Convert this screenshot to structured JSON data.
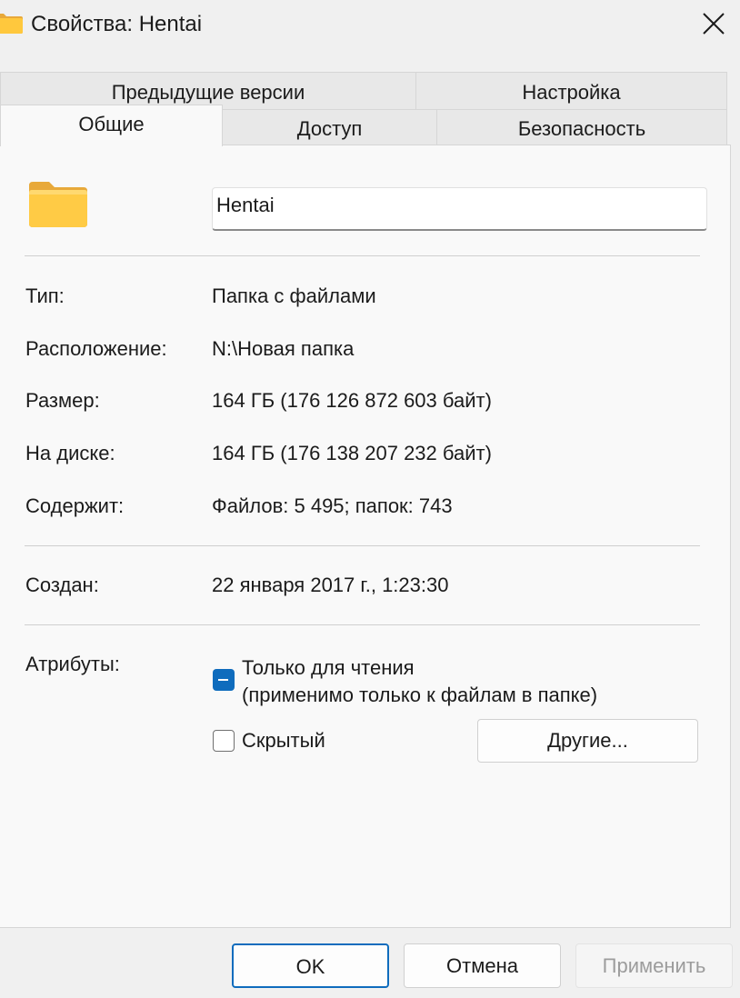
{
  "window": {
    "title": "Свойства: Hentai",
    "close_icon": "close-icon"
  },
  "tabs": {
    "previous_versions": "Предыдущие версии",
    "customize": "Настройка",
    "general": "Общие",
    "sharing": "Доступ",
    "security": "Безопасность",
    "active": "Общие"
  },
  "general": {
    "folder_icon": "folder-icon",
    "name_value": "Hentai",
    "type_label": "Тип:",
    "type_value": "Папка с файлами",
    "location_label": "Расположение:",
    "location_value": "N:\\Новая папка",
    "size_label": "Размер:",
    "size_value": "164 ГБ (176 126 872 603 байт)",
    "ondisk_label": "На диске:",
    "ondisk_value": "164 ГБ (176 138 207 232 байт)",
    "contains_label": "Содержит:",
    "contains_value": "Файлов: 5 495; папок: 743",
    "created_label": "Создан:",
    "created_value": "22 января 2017 г., 1:23:30",
    "attributes_label": "Атрибуты:",
    "readonly_label_line1": "Только для чтения",
    "readonly_label_line2": "(применимо только к файлам в папке)",
    "readonly_state": "indeterminate",
    "hidden_label": "Скрытый",
    "hidden_state": "unchecked",
    "advanced_button": "Другие..."
  },
  "footer": {
    "ok": "OK",
    "cancel": "Отмена",
    "apply": "Применить",
    "apply_enabled": false
  },
  "colors": {
    "accent": "#0f6cbd",
    "folder_yellow": "#ffc83d",
    "background": "#f0f0f0",
    "panel": "#f9f9f9"
  }
}
